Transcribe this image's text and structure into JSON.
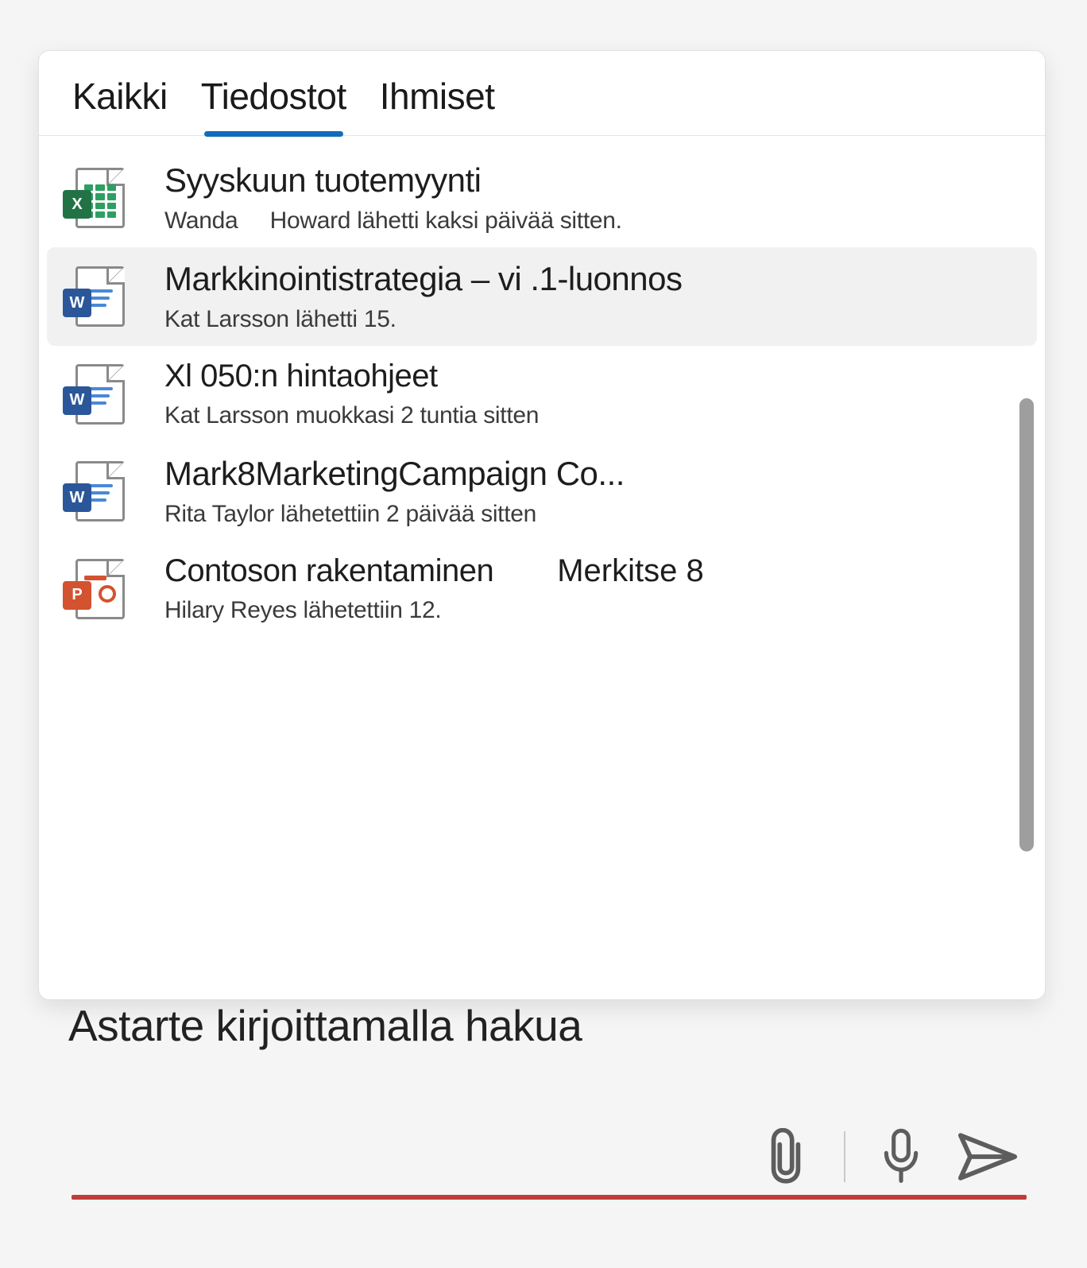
{
  "tabs": {
    "all": "Kaikki",
    "files": "Tiedostot",
    "people": "Ihmiset",
    "active_index": 1
  },
  "results": [
    {
      "icon": "excel",
      "title": "Syyskuun tuotemyynti",
      "meta": "Wanda     Howard lähetti kaksi päivää sitten.",
      "highlight": false
    },
    {
      "icon": "word",
      "title": "Markkinointistrategia – vi .1-luonnos",
      "meta": "Kat Larsson lähetti 15.",
      "highlight": true
    },
    {
      "icon": "word",
      "title": "Xl 050:n hintaohjeet",
      "meta": "Kat Larsson muokkasi 2 tuntia sitten",
      "highlight": false
    },
    {
      "icon": "word",
      "title": "Mark8MarketingCampaign Co...",
      "meta": "Rita Taylor lähetettiin 2 päivää sitten",
      "highlight": false
    },
    {
      "icon": "powerpoint",
      "title": "Contoson rakentaminen",
      "badge": "Merkitse 8",
      "meta": "Hilary Reyes lähetettiin 12.",
      "highlight": false
    }
  ],
  "compose": {
    "placeholder": "Astarte kirjoittamalla hakua"
  }
}
